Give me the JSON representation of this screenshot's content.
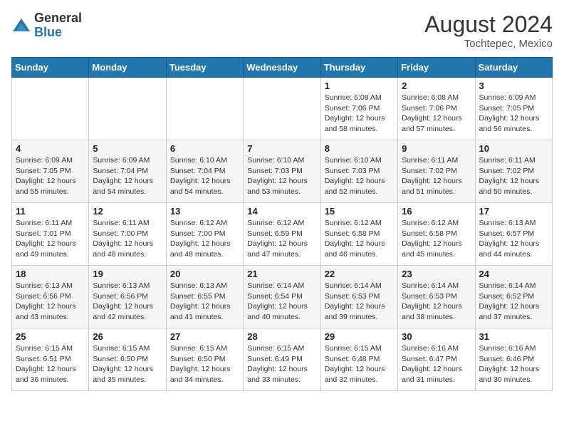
{
  "header": {
    "logo_general": "General",
    "logo_blue": "Blue",
    "month_year": "August 2024",
    "location": "Tochtepec, Mexico"
  },
  "weekdays": [
    "Sunday",
    "Monday",
    "Tuesday",
    "Wednesday",
    "Thursday",
    "Friday",
    "Saturday"
  ],
  "weeks": [
    [
      {
        "day": "",
        "info": ""
      },
      {
        "day": "",
        "info": ""
      },
      {
        "day": "",
        "info": ""
      },
      {
        "day": "",
        "info": ""
      },
      {
        "day": "1",
        "info": "Sunrise: 6:08 AM\nSunset: 7:06 PM\nDaylight: 12 hours\nand 58 minutes."
      },
      {
        "day": "2",
        "info": "Sunrise: 6:08 AM\nSunset: 7:06 PM\nDaylight: 12 hours\nand 57 minutes."
      },
      {
        "day": "3",
        "info": "Sunrise: 6:09 AM\nSunset: 7:05 PM\nDaylight: 12 hours\nand 56 minutes."
      }
    ],
    [
      {
        "day": "4",
        "info": "Sunrise: 6:09 AM\nSunset: 7:05 PM\nDaylight: 12 hours\nand 55 minutes."
      },
      {
        "day": "5",
        "info": "Sunrise: 6:09 AM\nSunset: 7:04 PM\nDaylight: 12 hours\nand 54 minutes."
      },
      {
        "day": "6",
        "info": "Sunrise: 6:10 AM\nSunset: 7:04 PM\nDaylight: 12 hours\nand 54 minutes."
      },
      {
        "day": "7",
        "info": "Sunrise: 6:10 AM\nSunset: 7:03 PM\nDaylight: 12 hours\nand 53 minutes."
      },
      {
        "day": "8",
        "info": "Sunrise: 6:10 AM\nSunset: 7:03 PM\nDaylight: 12 hours\nand 52 minutes."
      },
      {
        "day": "9",
        "info": "Sunrise: 6:11 AM\nSunset: 7:02 PM\nDaylight: 12 hours\nand 51 minutes."
      },
      {
        "day": "10",
        "info": "Sunrise: 6:11 AM\nSunset: 7:02 PM\nDaylight: 12 hours\nand 50 minutes."
      }
    ],
    [
      {
        "day": "11",
        "info": "Sunrise: 6:11 AM\nSunset: 7:01 PM\nDaylight: 12 hours\nand 49 minutes."
      },
      {
        "day": "12",
        "info": "Sunrise: 6:11 AM\nSunset: 7:00 PM\nDaylight: 12 hours\nand 48 minutes."
      },
      {
        "day": "13",
        "info": "Sunrise: 6:12 AM\nSunset: 7:00 PM\nDaylight: 12 hours\nand 48 minutes."
      },
      {
        "day": "14",
        "info": "Sunrise: 6:12 AM\nSunset: 6:59 PM\nDaylight: 12 hours\nand 47 minutes."
      },
      {
        "day": "15",
        "info": "Sunrise: 6:12 AM\nSunset: 6:58 PM\nDaylight: 12 hours\nand 46 minutes."
      },
      {
        "day": "16",
        "info": "Sunrise: 6:12 AM\nSunset: 6:58 PM\nDaylight: 12 hours\nand 45 minutes."
      },
      {
        "day": "17",
        "info": "Sunrise: 6:13 AM\nSunset: 6:57 PM\nDaylight: 12 hours\nand 44 minutes."
      }
    ],
    [
      {
        "day": "18",
        "info": "Sunrise: 6:13 AM\nSunset: 6:56 PM\nDaylight: 12 hours\nand 43 minutes."
      },
      {
        "day": "19",
        "info": "Sunrise: 6:13 AM\nSunset: 6:56 PM\nDaylight: 12 hours\nand 42 minutes."
      },
      {
        "day": "20",
        "info": "Sunrise: 6:13 AM\nSunset: 6:55 PM\nDaylight: 12 hours\nand 41 minutes."
      },
      {
        "day": "21",
        "info": "Sunrise: 6:14 AM\nSunset: 6:54 PM\nDaylight: 12 hours\nand 40 minutes."
      },
      {
        "day": "22",
        "info": "Sunrise: 6:14 AM\nSunset: 6:53 PM\nDaylight: 12 hours\nand 39 minutes."
      },
      {
        "day": "23",
        "info": "Sunrise: 6:14 AM\nSunset: 6:53 PM\nDaylight: 12 hours\nand 38 minutes."
      },
      {
        "day": "24",
        "info": "Sunrise: 6:14 AM\nSunset: 6:52 PM\nDaylight: 12 hours\nand 37 minutes."
      }
    ],
    [
      {
        "day": "25",
        "info": "Sunrise: 6:15 AM\nSunset: 6:51 PM\nDaylight: 12 hours\nand 36 minutes."
      },
      {
        "day": "26",
        "info": "Sunrise: 6:15 AM\nSunset: 6:50 PM\nDaylight: 12 hours\nand 35 minutes."
      },
      {
        "day": "27",
        "info": "Sunrise: 6:15 AM\nSunset: 6:50 PM\nDaylight: 12 hours\nand 34 minutes."
      },
      {
        "day": "28",
        "info": "Sunrise: 6:15 AM\nSunset: 6:49 PM\nDaylight: 12 hours\nand 33 minutes."
      },
      {
        "day": "29",
        "info": "Sunrise: 6:15 AM\nSunset: 6:48 PM\nDaylight: 12 hours\nand 32 minutes."
      },
      {
        "day": "30",
        "info": "Sunrise: 6:16 AM\nSunset: 6:47 PM\nDaylight: 12 hours\nand 31 minutes."
      },
      {
        "day": "31",
        "info": "Sunrise: 6:16 AM\nSunset: 6:46 PM\nDaylight: 12 hours\nand 30 minutes."
      }
    ]
  ]
}
